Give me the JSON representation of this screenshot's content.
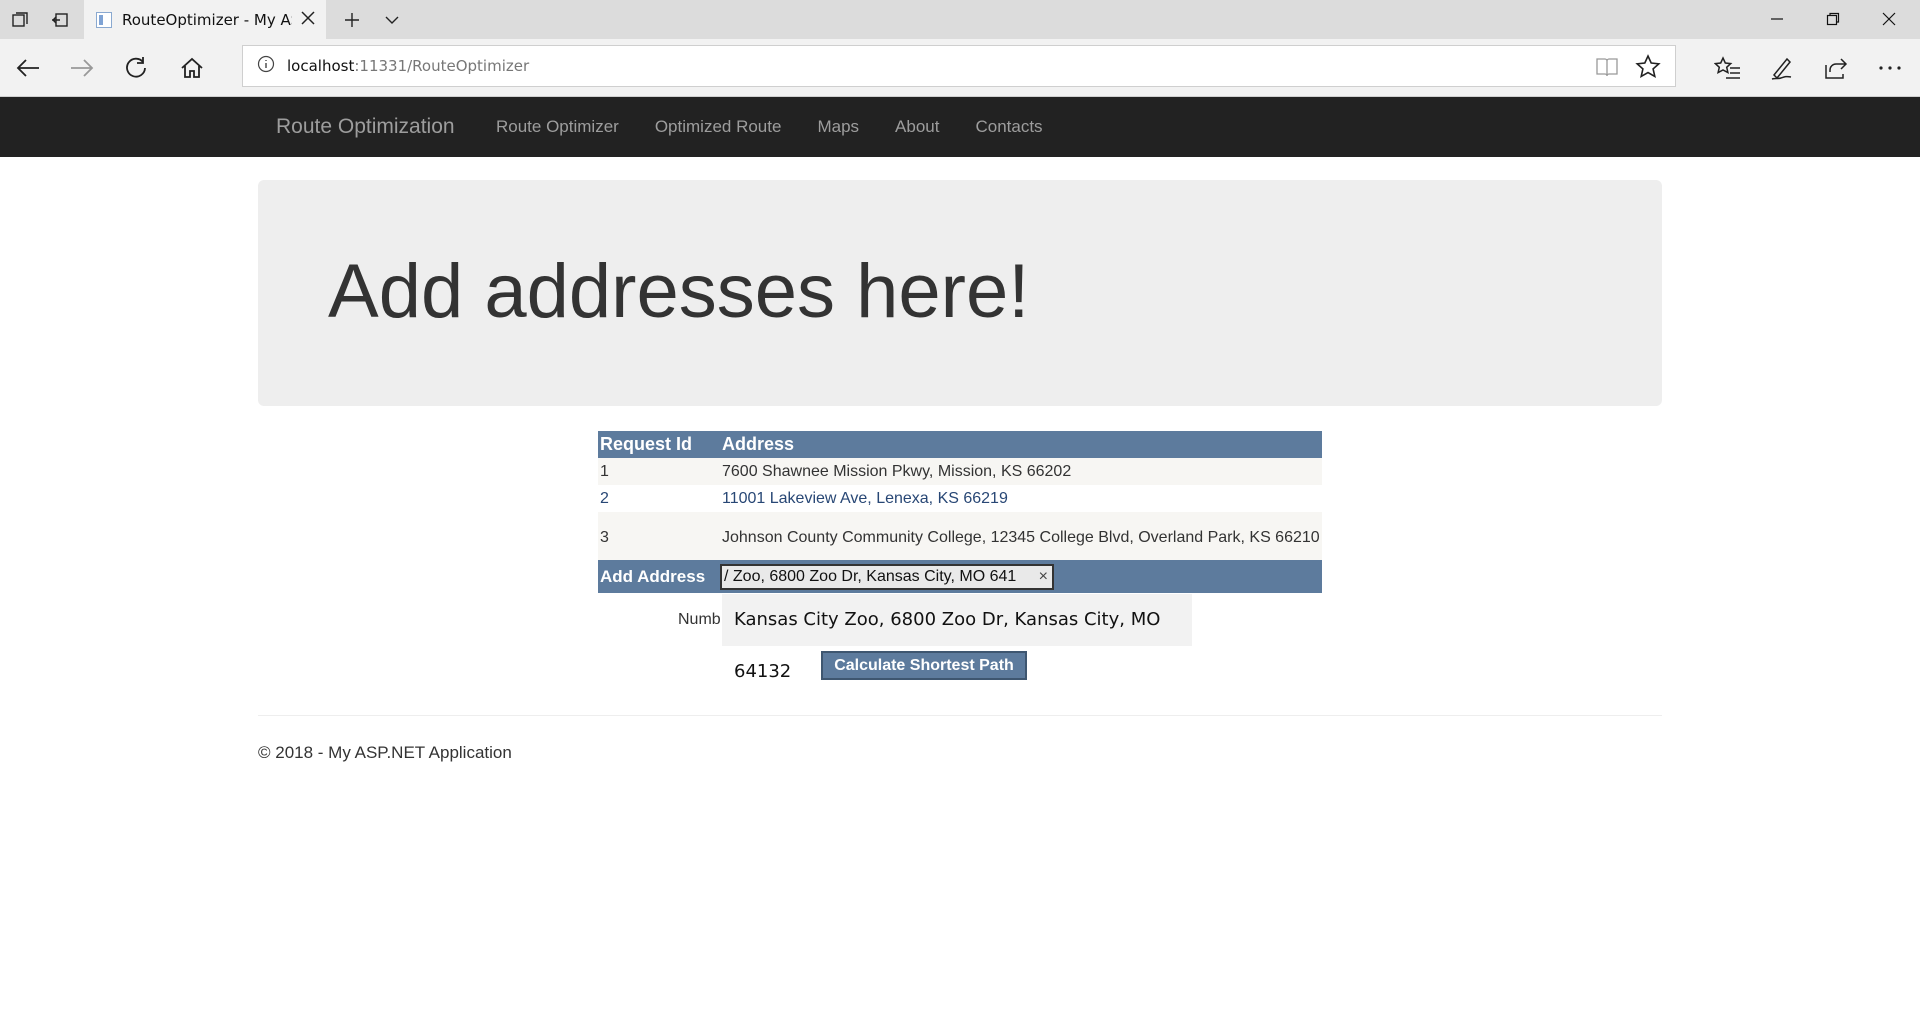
{
  "browser": {
    "tab_title": "RouteOptimizer - My ASP.NET Application",
    "url_host": "localhost",
    "url_rest": ":11331/RouteOptimizer"
  },
  "navbar": {
    "brand": "Route Optimization",
    "links": [
      {
        "label": "Route Optimizer"
      },
      {
        "label": "Optimized Route"
      },
      {
        "label": "Maps"
      },
      {
        "label": "About"
      },
      {
        "label": "Contacts"
      }
    ]
  },
  "jumbotron": {
    "heading": "Add addresses here!"
  },
  "grid": {
    "headers": {
      "id": "Request Id",
      "address": "Address"
    },
    "rows": [
      {
        "id": "1",
        "address": "7600 Shawnee Mission Pkwy, Mission, KS 66202"
      },
      {
        "id": "2",
        "address": "11001 Lakeview Ave, Lenexa, KS 66219"
      },
      {
        "id": "3",
        "address": "Johnson County Community College, 12345 College Blvd, Overland Park, KS 66210"
      }
    ]
  },
  "add_address": {
    "label": "Add Address",
    "value": "/ Zoo, 6800 Zoo Dr, Kansas City, MO 641",
    "clear_glyph": "×"
  },
  "number_label": "Numb",
  "suggestion": "Kansas City Zoo, 6800 Zoo Dr, Kansas City, MO 64132",
  "calculate_button": "Calculate Shortest Path",
  "footer": "© 2018 - My ASP.NET Application",
  "colors": {
    "navbar_bg": "#222222",
    "grid_header": "#5d7b9d",
    "link_text": "#284775"
  }
}
